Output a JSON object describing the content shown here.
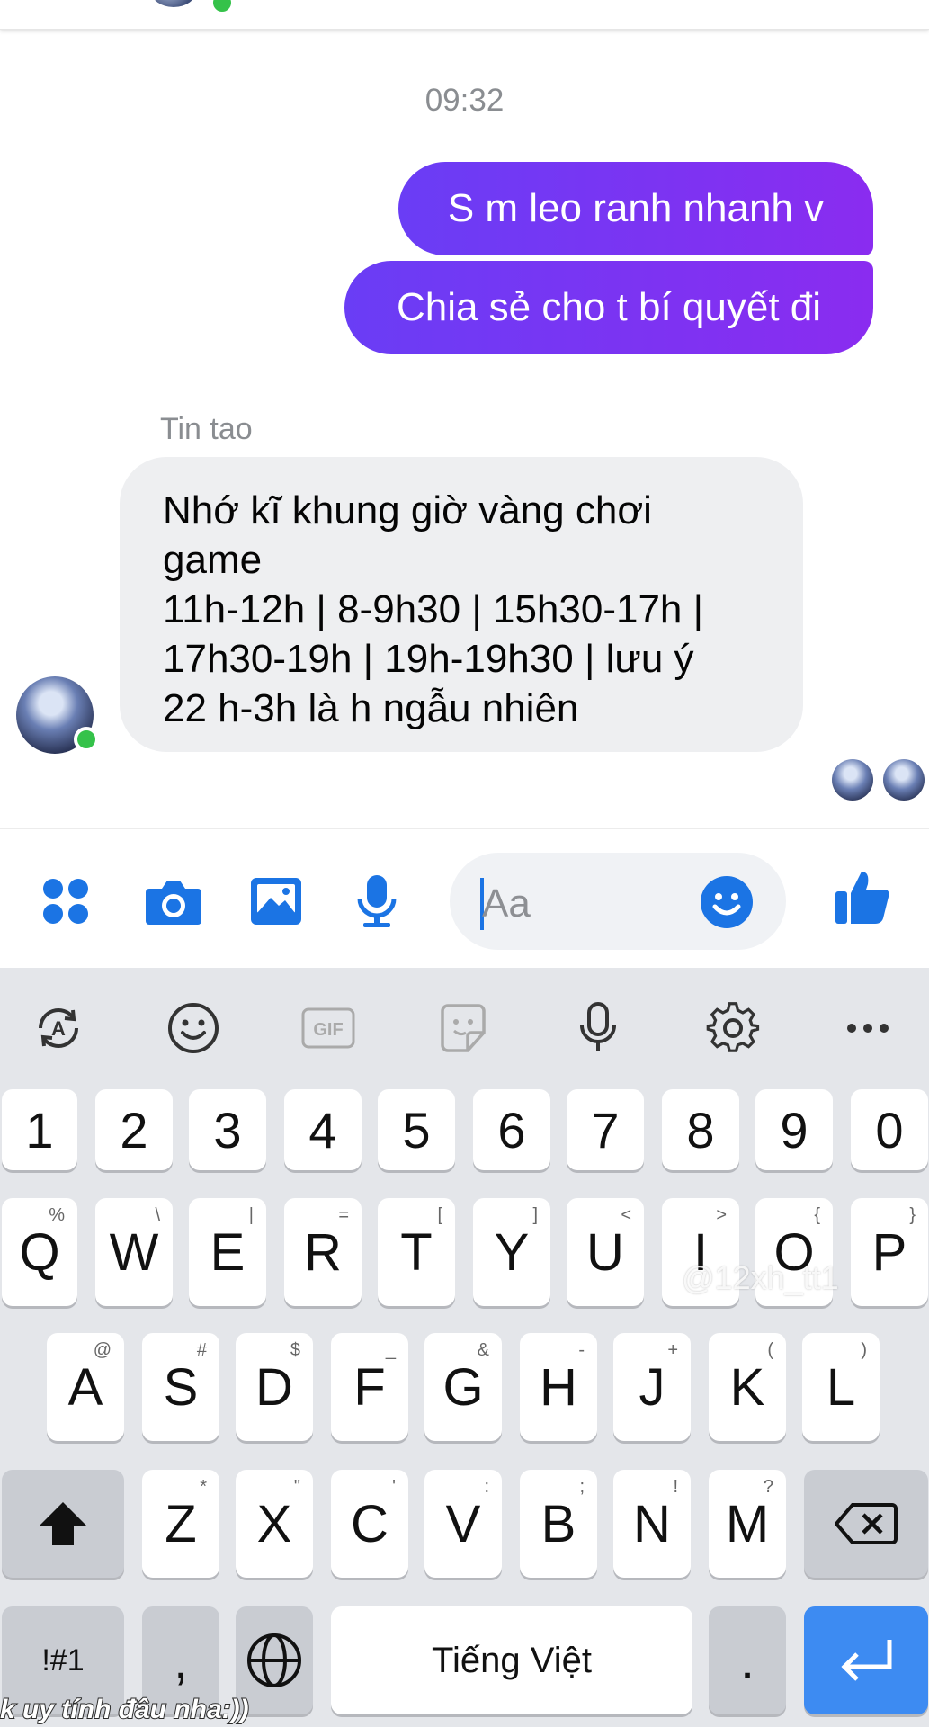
{
  "conversation": {
    "timestamp": "09:32",
    "outgoing": [
      "S m leo ranh nhanh v",
      "Chia sẻ cho t bí quyết đi"
    ],
    "incoming_sender": "Tin tao",
    "incoming_lines": [
      "Nhớ kĩ khung giờ vàng chơi",
      "game",
      "11h-12h | 8-9h30 | 15h30-17h |",
      "17h30-19h | 19h-19h30 | lưu ý",
      "22 h-3h là h ngẫu nhiên"
    ]
  },
  "composer": {
    "placeholder": "Aa",
    "icons": [
      "apps-icon",
      "camera-icon",
      "gallery-icon",
      "mic-icon",
      "emoji-icon",
      "like-icon"
    ],
    "accent_color": "#1b74e4"
  },
  "keyboard": {
    "toolbar": [
      "translate-icon",
      "emoji-icon",
      "GIF",
      "sticker-icon",
      "mic-icon",
      "settings-icon",
      "more-icon"
    ],
    "number_row": [
      "1",
      "2",
      "3",
      "4",
      "5",
      "6",
      "7",
      "8",
      "9",
      "0"
    ],
    "row1": [
      "Q",
      "W",
      "E",
      "R",
      "T",
      "Y",
      "U",
      "I",
      "O",
      "P"
    ],
    "row1_hints": [
      "%",
      "\\",
      "|",
      "=",
      "[",
      "]",
      "<",
      ">",
      "{",
      "}"
    ],
    "row2": [
      "A",
      "S",
      "D",
      "F",
      "G",
      "H",
      "J",
      "K",
      "L"
    ],
    "row2_hints": [
      "@",
      "#",
      "$",
      "_",
      "&",
      "-",
      "+",
      "(",
      ")"
    ],
    "row3": [
      "Z",
      "X",
      "C",
      "V",
      "B",
      "N",
      "M"
    ],
    "row3_hints": [
      "*",
      "\"",
      "'",
      ":",
      ";",
      "!",
      "?"
    ],
    "symbols_key": "!#1",
    "comma_key": ",",
    "space_label": "Tiếng Việt",
    "period_key": "."
  },
  "overlay": {
    "watermark": "@12xh_tt1",
    "caption": "k uy tính đâu nha:))"
  }
}
